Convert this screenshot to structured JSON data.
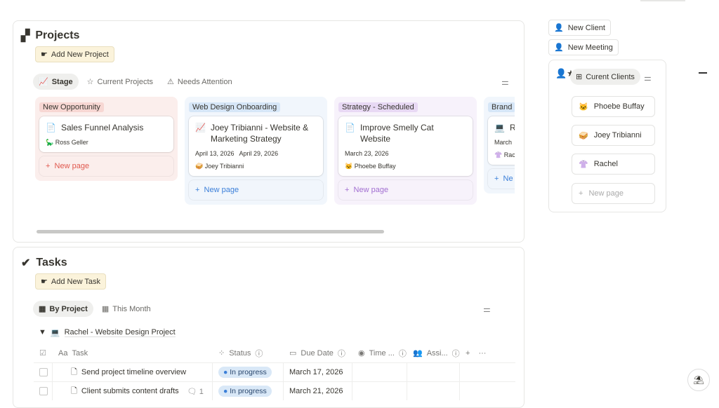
{
  "projects": {
    "title": "Projects",
    "add_label": "Add New Project",
    "tabs": [
      {
        "label": "Stage",
        "icon": "chart-line-icon"
      },
      {
        "label": "Current Projects",
        "icon": "star-icon"
      },
      {
        "label": "Needs Attention",
        "icon": "warning-icon"
      }
    ],
    "columns": [
      {
        "stage": "New Opportunity",
        "color": "#fbeeec",
        "tag_bg": "#f7d7d3",
        "accent": "#e0584e",
        "cards": [
          {
            "title": "Sales Funnel Analysis",
            "icon": "📄",
            "person": "🦕 Ross Geller"
          }
        ],
        "new_label": "New page"
      },
      {
        "stage": "Web Design Onboarding",
        "color": "#f1f6fc",
        "tag_bg": "#d6e6f7",
        "accent": "#3b7fd9",
        "cards": [
          {
            "title": "Joey Tribianni - Website & Marketing Strategy",
            "icon": "📈",
            "dates": "April 13, 2026   April 29, 2026",
            "person": "🥪 Joey Tribianni"
          }
        ],
        "new_label": "New page"
      },
      {
        "stage": "Strategy - Scheduled",
        "color": "#f7f2fb",
        "tag_bg": "#e8d9f4",
        "accent": "#a26fd1",
        "cards": [
          {
            "title": "Improve Smelly Cat Website",
            "icon": "📄",
            "dates": "March 23, 2026",
            "person": "🐱 Phoebe Buffay"
          }
        ],
        "new_label": "New page"
      },
      {
        "stage": "Brand",
        "color": "#f1f6fc",
        "tag_bg": "#d6e6f7",
        "accent": "#3b7fd9",
        "cards": [
          {
            "title": "Ra Pr",
            "icon": "💻",
            "dates": "March",
            "person": "👚 Rac"
          }
        ],
        "new_label": "Ne"
      }
    ]
  },
  "tasks": {
    "title": "Tasks",
    "add_label": "Add New Task",
    "tabs": [
      {
        "label": "By Project"
      },
      {
        "label": "This Month"
      }
    ],
    "group": "Rachel - Website Design Project",
    "headers": {
      "task": "Task",
      "status": "Status",
      "due": "Due Date",
      "time": "Time ...",
      "assignee": "Assi..."
    },
    "rows": [
      {
        "task": "Send project timeline overview",
        "comments": "",
        "status": "In progress",
        "due": "March 17, 2026"
      },
      {
        "task": "Client submits content drafts",
        "comments": "1",
        "status": "In progress",
        "due": "March 21, 2026"
      }
    ]
  },
  "sidebar": {
    "new_client": "New Client",
    "new_meeting": "New Meeting",
    "clients_view": "Curent Clients",
    "clients": [
      {
        "emoji": "🐱",
        "name": "Phoebe Buffay"
      },
      {
        "emoji": "🥪",
        "name": "Joey Tribianni"
      },
      {
        "emoji": "👚",
        "name": "Rachel"
      }
    ],
    "new_label": "New page"
  }
}
